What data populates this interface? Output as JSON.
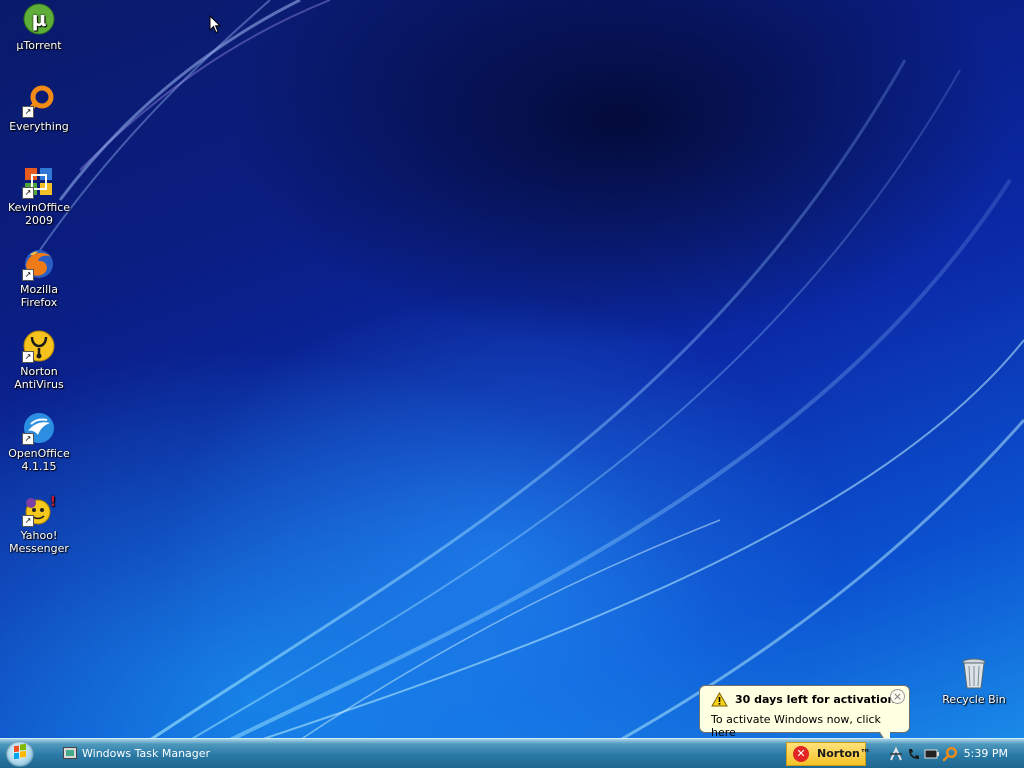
{
  "desktop": {
    "icons": [
      {
        "label": "µTorrent",
        "icon": "utorrent-icon"
      },
      {
        "label": "Everything",
        "icon": "everything-search-icon"
      },
      {
        "label": "KevinOffice 2009",
        "icon": "office-icon"
      },
      {
        "label": "Mozilla Firefox",
        "icon": "firefox-icon"
      },
      {
        "label": "Norton AntiVirus",
        "icon": "norton-antivirus-icon"
      },
      {
        "label": "OpenOffice 4.1.15",
        "icon": "openoffice-icon"
      },
      {
        "label": "Yahoo! Messenger",
        "icon": "yahoo-messenger-icon"
      },
      {
        "label": "Recycle Bin",
        "icon": "recycle-bin-icon"
      }
    ]
  },
  "taskbar": {
    "start_icon": "start-orb-icon",
    "task_label": "Windows Task Manager",
    "norton_label": "Norton™",
    "tray_icons": [
      "network-icon",
      "phone-icon",
      "battery-icon",
      "search-icon"
    ],
    "clock": "5:39 PM"
  },
  "notification": {
    "title": "30 days left for activation",
    "body": "To activate Windows now, click here",
    "icon": "warning-icon",
    "close_glyph": "×"
  },
  "colors": {
    "taskbar": "#2a7aa6",
    "balloon_bg": "#ffffe1",
    "norton_yellow": "#f3c227"
  }
}
